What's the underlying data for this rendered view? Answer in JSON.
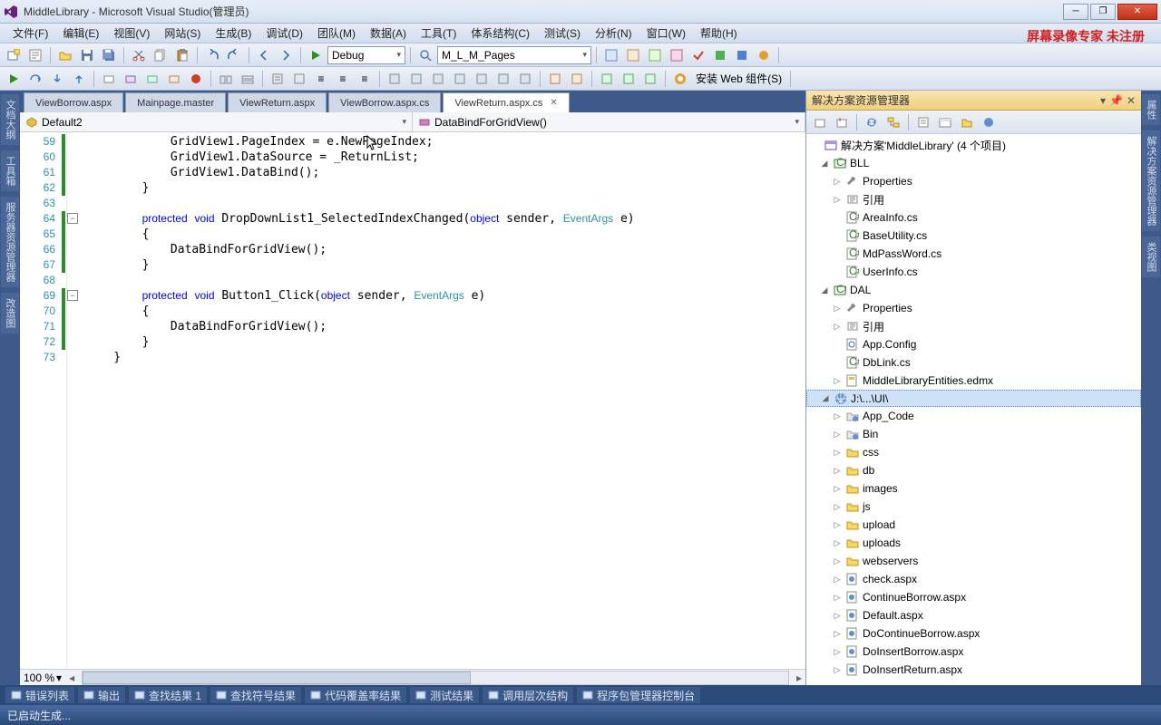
{
  "title": "MiddleLibrary - Microsoft Visual Studio(管理员)",
  "watermark": "屏幕录像专家 未注册",
  "menu": [
    "文件(F)",
    "编辑(E)",
    "视图(V)",
    "网站(S)",
    "生成(B)",
    "调试(D)",
    "团队(M)",
    "数据(A)",
    "工具(T)",
    "体系结构(C)",
    "测试(S)",
    "分析(N)",
    "窗口(W)",
    "帮助(H)"
  ],
  "toolbar1": {
    "config": "Debug",
    "search": "M_L_M_Pages",
    "install": "安装 Web 组件(S)"
  },
  "tabs": [
    {
      "label": "ViewBorrow.aspx"
    },
    {
      "label": "Mainpage.master"
    },
    {
      "label": "ViewReturn.aspx"
    },
    {
      "label": "ViewBorrow.aspx.cs"
    },
    {
      "label": "ViewReturn.aspx.cs",
      "active": true
    }
  ],
  "classDropdown": "Default2",
  "methodDropdown": "DataBindForGridView()",
  "lines": [
    59,
    60,
    61,
    62,
    63,
    64,
    65,
    66,
    67,
    68,
    69,
    70,
    71,
    72,
    73
  ],
  "zoom": "100 %",
  "solutionExplorer": {
    "title": "解决方案资源管理器",
    "root": "解决方案'MiddleLibrary' (4 个项目)",
    "projects": [
      {
        "name": "BLL",
        "children": [
          {
            "name": "Properties",
            "kind": "props"
          },
          {
            "name": "引用",
            "kind": "ref"
          },
          {
            "name": "AreaInfo.cs",
            "kind": "cs"
          },
          {
            "name": "BaseUtility.cs",
            "kind": "cs"
          },
          {
            "name": "MdPassWord.cs",
            "kind": "cs"
          },
          {
            "name": "UserInfo.cs",
            "kind": "cs"
          }
        ]
      },
      {
        "name": "DAL",
        "children": [
          {
            "name": "Properties",
            "kind": "props"
          },
          {
            "name": "引用",
            "kind": "ref"
          },
          {
            "name": "App.Config",
            "kind": "config"
          },
          {
            "name": "DbLink.cs",
            "kind": "cs"
          },
          {
            "name": "MiddleLibraryEntities.edmx",
            "kind": "edmx"
          }
        ]
      },
      {
        "name": "J:\\...\\UI\\",
        "selected": true,
        "children": [
          {
            "name": "App_Code",
            "kind": "folder2"
          },
          {
            "name": "Bin",
            "kind": "folder2"
          },
          {
            "name": "css",
            "kind": "folder"
          },
          {
            "name": "db",
            "kind": "folder"
          },
          {
            "name": "images",
            "kind": "folder"
          },
          {
            "name": "js",
            "kind": "folder"
          },
          {
            "name": "upload",
            "kind": "folder"
          },
          {
            "name": "uploads",
            "kind": "folder"
          },
          {
            "name": "webservers",
            "kind": "folder"
          },
          {
            "name": "check.aspx",
            "kind": "aspx"
          },
          {
            "name": "ContinueBorrow.aspx",
            "kind": "aspx"
          },
          {
            "name": "Default.aspx",
            "kind": "aspx"
          },
          {
            "name": "DoContinueBorrow.aspx",
            "kind": "aspx"
          },
          {
            "name": "DoInsertBorrow.aspx",
            "kind": "aspx"
          },
          {
            "name": "DoInsertReturn.aspx",
            "kind": "aspx"
          }
        ]
      }
    ]
  },
  "bottomTabs": [
    "错误列表",
    "输出",
    "查找结果 1",
    "查找符号结果",
    "代码覆盖率结果",
    "测试结果",
    "调用层次结构",
    "程序包管理器控制台"
  ],
  "status": "已启动生成...",
  "leftDock": [
    "文档大纲",
    "工具箱",
    "服务器资源管理器",
    "改造图"
  ],
  "rightDock": [
    "属性",
    "解决方案资源管理器",
    "类视图"
  ]
}
